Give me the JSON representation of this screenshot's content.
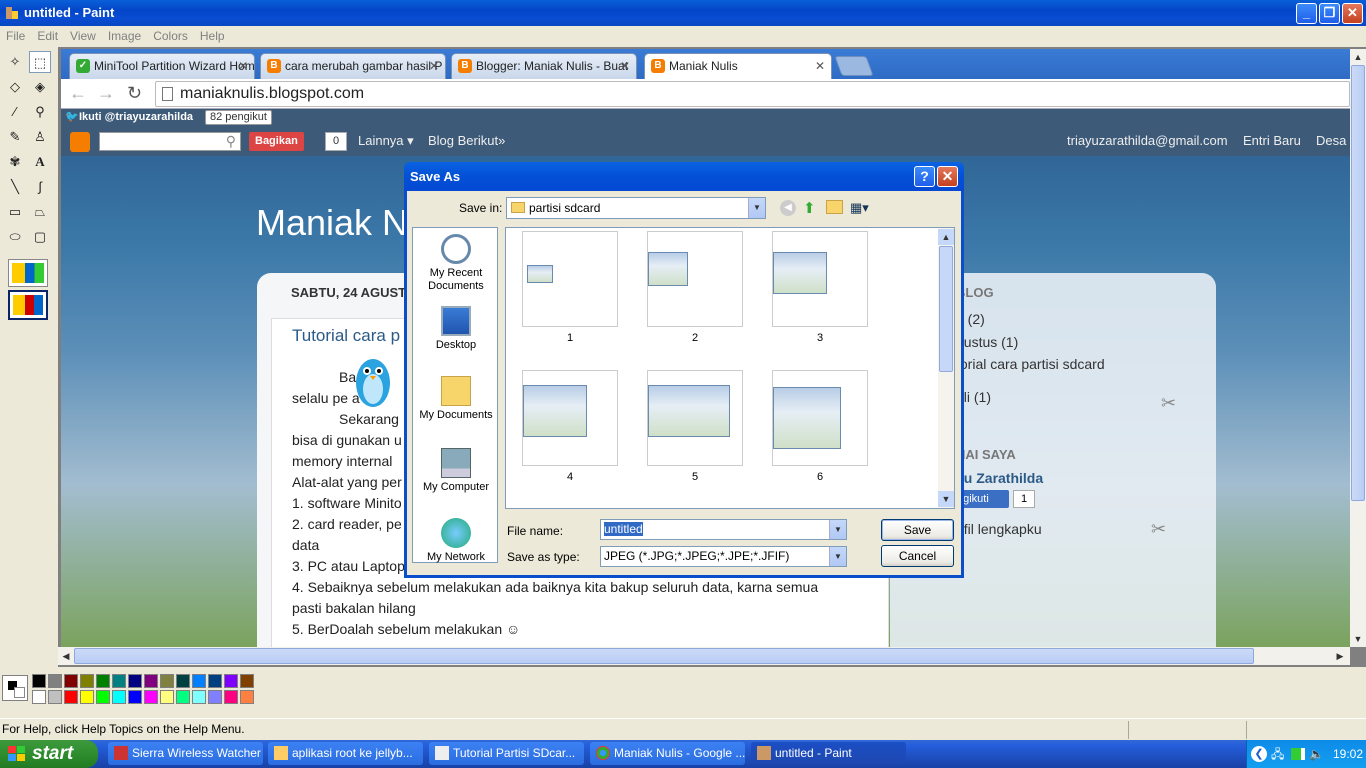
{
  "window": {
    "title": "untitled - Paint"
  },
  "menu": [
    "File",
    "Edit",
    "View",
    "Image",
    "Colors",
    "Help"
  ],
  "browser": {
    "tabs": [
      {
        "label": "MiniTool Partition Wizard Hom"
      },
      {
        "label": "cara merubah gambar hasil P"
      },
      {
        "label": "Blogger: Maniak Nulis - Buat"
      },
      {
        "label": "Maniak Nulis"
      }
    ],
    "address": "maniaknulis.blogspot.com"
  },
  "blog": {
    "twitter_follow": "Ikuti @triayuzarahilda",
    "twitter_count": "82 pengikut",
    "share_label": "Bagikan",
    "share_count": "0",
    "more_label": "Lainnya ▾",
    "next_blog": "Blog Berikut»",
    "user_email": "triayuzarathilda@gmail.com",
    "new_post": "Entri Baru",
    "design": "Desa",
    "title": "Maniak Nu",
    "date": "SABTU, 24 AGUST",
    "post_title": "Tutorial cara p",
    "post_lines": [
      "Ba         alia",
      "selalu pe        a",
      "Sekarang",
      "bisa di gunakan u",
      "memory internal",
      "Alat-alat yang per",
      "1. software Minito",
      "2. card reader, pe",
      "data",
      "3. PC atau Laptop",
      "4. Sebaiknya sebelum melakukan ada baiknya kita bakup seluruh data, karna semua",
      "pasti bakalan hilang",
      "5. BerDoalah sebelum melakukan ☺"
    ],
    "sidebar": {
      "archive_heading": "BLOG",
      "items": [
        "3 (2)",
        "gustus (1)",
        "torial cara partisi sdcard",
        "uli (1)"
      ],
      "about_heading": "NAI SAYA",
      "author": "yu Zarathilda",
      "follow_label": "ngikuti",
      "follow_count": "1",
      "profile_link": "ofil lengkapku"
    }
  },
  "dialog": {
    "title": "Save As",
    "save_in_label": "Save in:",
    "save_in_value": "partisi sdcard",
    "places": [
      "My Recent Documents",
      "Desktop",
      "My Documents",
      "My Computer",
      "My Network"
    ],
    "files": [
      "1",
      "2",
      "3",
      "4",
      "5",
      "6"
    ],
    "file_name_label": "File name:",
    "file_name_value": "untitled",
    "save_type_label": "Save as type:",
    "save_type_value": "JPEG (*.JPG;*.JPEG;*.JPE;*.JFIF)",
    "save_button": "Save",
    "cancel_button": "Cancel"
  },
  "status": {
    "help_text": "For Help, click Help Topics on the Help Menu."
  },
  "taskbar": {
    "start": "start",
    "tasks": [
      "Sierra Wireless Watcher",
      "aplikasi root ke jellyb...",
      "Tutorial Partisi SDcar...",
      "Maniak Nulis - Google ...",
      "untitled - Paint"
    ],
    "clock": "19:02"
  },
  "palette": {
    "top": [
      "#000000",
      "#808080",
      "#800000",
      "#808000",
      "#008000",
      "#008080",
      "#000080",
      "#800080",
      "#808040",
      "#004040",
      "#0080ff",
      "#004080",
      "#8000ff",
      "#804000"
    ],
    "bottom": [
      "#ffffff",
      "#c0c0c0",
      "#ff0000",
      "#ffff00",
      "#00ff00",
      "#00ffff",
      "#0000ff",
      "#ff00ff",
      "#ffff80",
      "#00ff80",
      "#80ffff",
      "#8080ff",
      "#ff0080",
      "#ff8040"
    ]
  }
}
